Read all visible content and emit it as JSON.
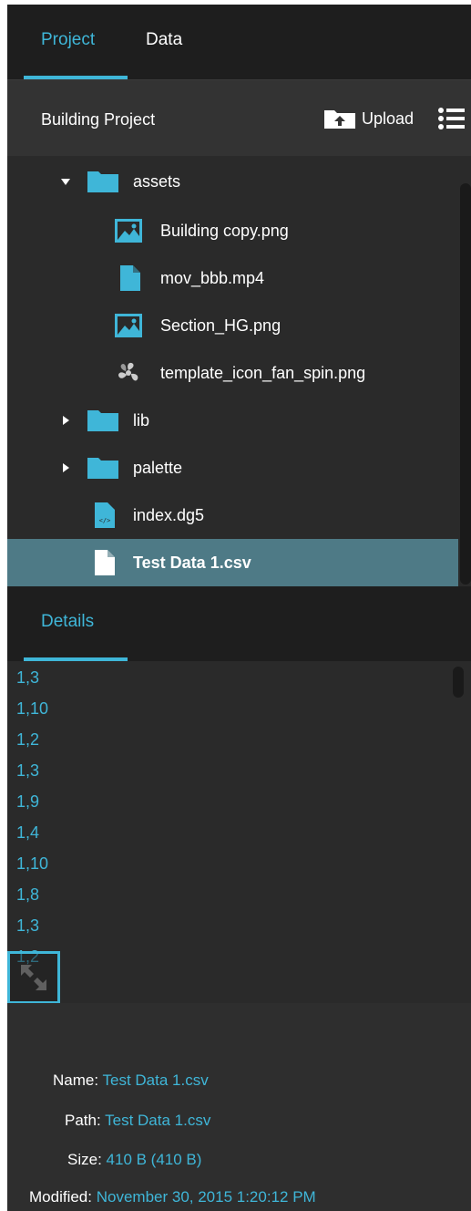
{
  "tabs": {
    "project": "Project",
    "data": "Data"
  },
  "project": {
    "title": "Building Project",
    "upload_label": "Upload"
  },
  "tree": [
    {
      "label": "assets",
      "type": "folder",
      "expanded": true
    },
    {
      "label": "Building copy.png",
      "type": "image"
    },
    {
      "label": "mov_bbb.mp4",
      "type": "file"
    },
    {
      "label": "Section_HG.png",
      "type": "image"
    },
    {
      "label": "template_icon_fan_spin.png",
      "type": "fan"
    },
    {
      "label": "lib",
      "type": "folder",
      "expanded": false
    },
    {
      "label": "palette",
      "type": "folder",
      "expanded": false
    },
    {
      "label": "index.dg5",
      "type": "code"
    },
    {
      "label": "Test Data 1.csv",
      "type": "file",
      "selected": true
    }
  ],
  "details": {
    "tab": "Details"
  },
  "content_lines": [
    "1,3",
    "1,10",
    "1,2",
    "1,3",
    "1,9",
    "1,4",
    "1,10",
    "1,8",
    "1,3",
    "1,2"
  ],
  "meta": {
    "name_key": "Name:",
    "name_val": "Test Data 1.csv",
    "path_key": "Path:",
    "path_val": "Test Data 1.csv",
    "size_key": "Size:",
    "size_val": "410 B (410 B)",
    "modified_key": "Modified:",
    "modified_val": "November 30, 2015 1:20:12 PM"
  },
  "colors": {
    "accent": "#3fb6d8",
    "selected": "#4e7a86",
    "bg": "#2a2a2a"
  }
}
